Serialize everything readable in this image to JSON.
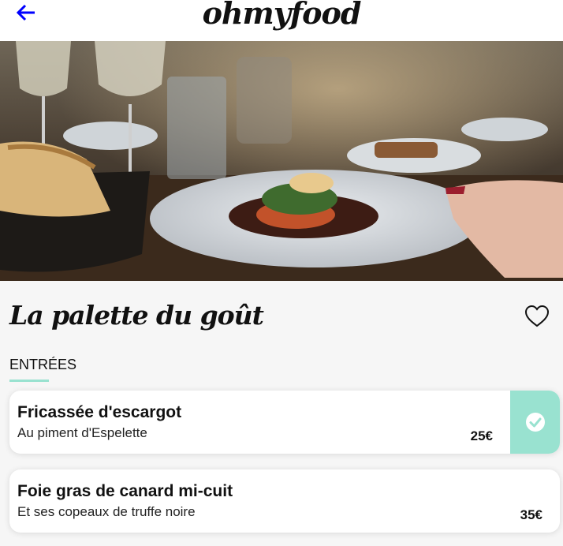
{
  "header": {
    "logo": "ohmyfood",
    "back_icon": "arrow-left-icon"
  },
  "hero": {
    "image": "restaurant-dining-table-photo"
  },
  "restaurant": {
    "name": "La palette du goût",
    "favorite_icon": "heart-outline-icon"
  },
  "menu": {
    "section_title": "ENTRÉES",
    "items": [
      {
        "name": "Fricassée d'escargot",
        "description": "Au piment d'Espelette",
        "price": "25€",
        "selected": true
      },
      {
        "name": "Foie gras de canard mi-cuit",
        "description": "Et ses copeaux de truffe noire",
        "price": "35€",
        "selected": false
      }
    ]
  },
  "colors": {
    "accent": "#99e2d0",
    "back_arrow": "#0000ff",
    "text": "#111111"
  }
}
